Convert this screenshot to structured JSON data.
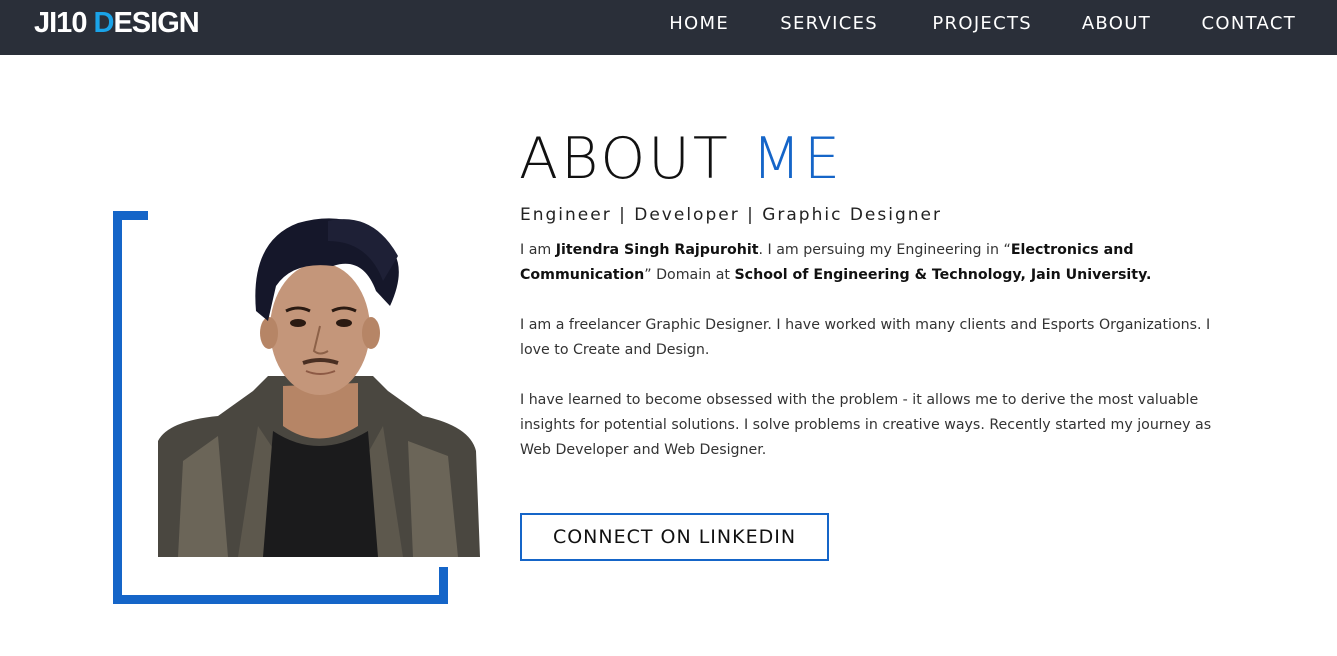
{
  "brand": {
    "logo_part1": "JI10 ",
    "logo_accent": "D",
    "logo_part2": "ESIGN",
    "accent_color": "#1aa3e8"
  },
  "nav": {
    "items": [
      {
        "label": "HOME"
      },
      {
        "label": "SERVICES"
      },
      {
        "label": "PROJECTS"
      },
      {
        "label": "ABOUT"
      },
      {
        "label": "CONTACT"
      }
    ]
  },
  "about": {
    "title_main": "ABOUT ",
    "title_accent": "ME",
    "subtitle": "Engineer | Developer | Graphic Designer",
    "p1": {
      "t1": "I am ",
      "name": "Jitendra Singh Rajpurohit",
      "t2": ". I am persuing my Engineering in “",
      "field": "Electronics and Communication",
      "t3": "” Domain at ",
      "school": "School of Engineering & Technology, Jain University."
    },
    "p2": "I am a freelancer Graphic Designer. I have worked with many clients and Esports Organizations. I love to Create and Design.",
    "p3": "I have learned to become obsessed with the problem - it allows me to derive the most valuable insights for potential solutions. I solve problems in creative ways. Recently started my journey as Web Developer and Web Designer.",
    "button_label": "CONNECT ON LINKEDIN",
    "accent_color": "#1565c8"
  }
}
